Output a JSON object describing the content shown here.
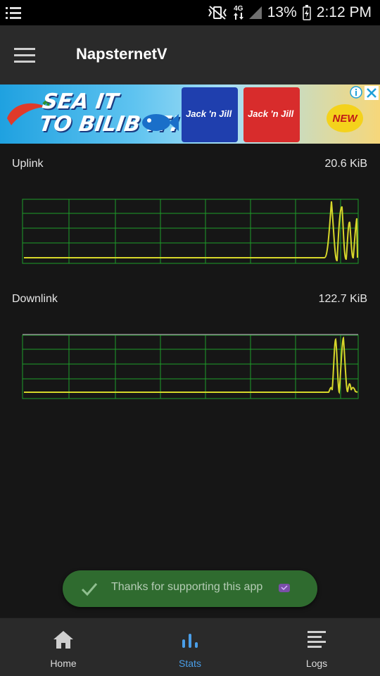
{
  "status_bar": {
    "network": "4G",
    "battery": "13%",
    "time": "2:12 PM"
  },
  "app": {
    "title": "NapsternetV"
  },
  "ad": {
    "headline_line1": "SEA IT",
    "headline_line2": "TO BILIB IT!",
    "product_1": "Jack 'n Jill",
    "product_2": "Jack 'n Jill",
    "badge": "NEW"
  },
  "stats": {
    "uplink": {
      "label": "Uplink",
      "value": "20.6 KiB"
    },
    "downlink": {
      "label": "Downlink",
      "value": "122.7 KiB"
    }
  },
  "toast": {
    "message": "Thanks for supporting this app"
  },
  "bottom_nav": {
    "items": [
      {
        "label": "Home",
        "icon": "home-icon",
        "active": false
      },
      {
        "label": "Stats",
        "icon": "bar-chart-icon",
        "active": true
      },
      {
        "label": "Logs",
        "icon": "list-icon",
        "active": false
      }
    ]
  },
  "colors": {
    "graph_grid": "#1f9d2a",
    "graph_line": "#d6d62a",
    "accent": "#4a9ee8",
    "toast_bg": "#2f6b2f"
  }
}
